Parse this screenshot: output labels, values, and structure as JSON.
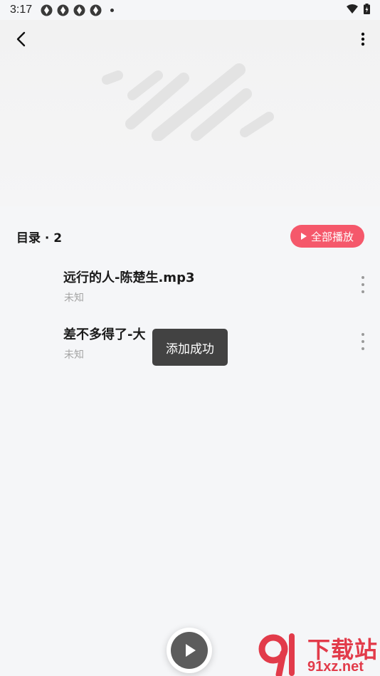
{
  "status_bar": {
    "time": "3:17"
  },
  "header": {},
  "directory": {
    "title": "目录 · 2",
    "play_all_label": "全部播放"
  },
  "tracks": [
    {
      "title": "远行的人-陈楚生.mp3",
      "artist": "未知"
    },
    {
      "title": "差不多得了-大",
      "artist": "未知"
    }
  ],
  "toast": {
    "message": "添加成功"
  },
  "watermark": {
    "text": "下载站",
    "url": "91xz.net"
  },
  "colors": {
    "accent": "#f5586b",
    "toast_bg": "#323232",
    "muted_text": "#a5a5a5"
  }
}
